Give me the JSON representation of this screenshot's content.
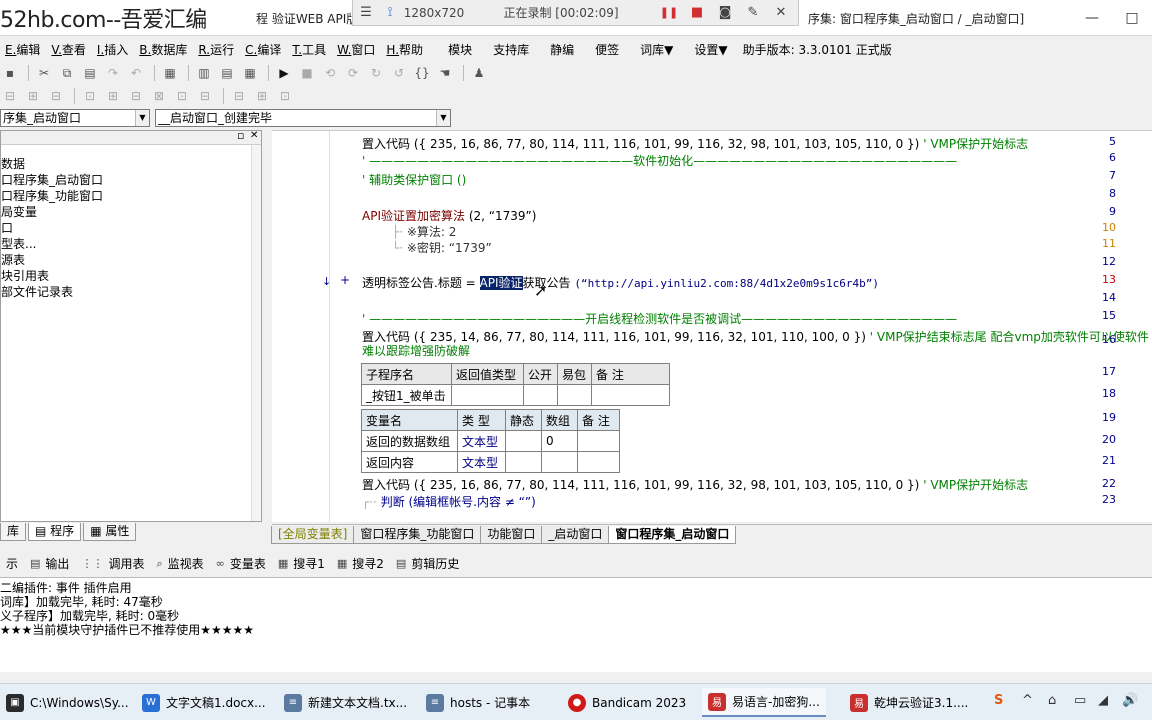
{
  "title_bar": {
    "watermark": "52hb.com--吾爱汇编",
    "title_mid": "程  验证WEB API版本",
    "title_right": "序集: 窗口程序集_启动窗口 / _启动窗口]",
    "minimize": "—",
    "maximize": "□",
    "close": "✕"
  },
  "recorder": {
    "menu_icon": "☰",
    "pin_icon": "⟟",
    "resolution": "1280x720",
    "status": "正在录制 [00:02:09]",
    "pause": "❚❚",
    "stop": "■",
    "camera": "◙",
    "pen": "✎",
    "close": "✕",
    "colors": {
      "pause": "#d03030",
      "stop": "#d03030"
    }
  },
  "menu": [
    {
      "label": "E.编辑"
    },
    {
      "label": "V.查看"
    },
    {
      "label": "I.插入"
    },
    {
      "label": "B.数据库"
    },
    {
      "label": "R.运行"
    },
    {
      "label": "C.编译"
    },
    {
      "label": "T.工具"
    },
    {
      "label": "W.窗口"
    },
    {
      "label": "H.帮助"
    },
    {
      "label": "模块"
    },
    {
      "label": "支持库"
    },
    {
      "label": "静编"
    },
    {
      "label": "便签"
    },
    {
      "label": "词库▼"
    },
    {
      "label": "设置▼"
    },
    {
      "label": "助手版本: 3.3.0101 正式版"
    }
  ],
  "combos": {
    "left": "序集_启动窗口",
    "right": "__启动窗口_创建完毕",
    "arrow": "▼"
  },
  "tree": {
    "pin": "▫",
    "close": "✕",
    "items": [
      "数据",
      "口程序集_启动窗口",
      "口程序集_功能窗口",
      "局变量",
      "口",
      "型表...",
      "源表",
      "块引用表",
      "部文件记录表"
    ]
  },
  "left_tabs": [
    "库",
    "程序",
    "属性"
  ],
  "editor": {
    "line_numbers": [
      "5",
      "6",
      "7",
      "8",
      "9",
      "10",
      "11",
      "12",
      "13",
      "14",
      "15",
      "16",
      "17",
      "18",
      "19",
      "20",
      "21",
      "22",
      "23"
    ],
    "lines": {
      "l5_func": "置入代码",
      "l5_args": "({ 235, 16, 86, 77, 80, 114, 111, 116, 101, 99, 116, 32, 98, 101, 103, 105, 110, 0 })",
      "l5_comment": "' VMP保护开始标志",
      "l6_comment": "' ——————————————————————软件初始化——————————————————————",
      "l7_comment": "' 辅助类保护窗口 ()",
      "l9_func": "API验证置加密算法",
      "l9_args": "(2, “1739”)",
      "l10_param": "※算法: 2",
      "l11_param": "※密钥: “1739”",
      "l13_lhs": "透明标签公告.标题 = ",
      "l13_sel": "API验证",
      "l13_rest": "获取公告",
      "l13_str": "(“http://api.yinliu2.com:88/4d1x2e0m9s1c6r4b”)",
      "l15_comment": "' ——————————————————开启线程检测软件是否被调试——————————————————",
      "l16_func": "置入代码",
      "l16_args": "({ 235, 14, 86, 77, 80, 114, 111, 116, 101, 99, 116, 32, 101, 110, 100, 0 })",
      "l16_comment": "' VMP保护结束标志尾  配合vmp加壳软件可以使软件",
      "l16_cont": "难以跟踪增强防破解",
      "l22_func": "置入代码",
      "l22_args": "({ 235, 16, 86, 77, 80, 114, 111, 116, 101, 99, 116, 32, 98, 101, 103, 105, 110, 0 })",
      "l22_comment": "' VMP保护开始标志",
      "l23_code": "判断 (编辑框帐号.内容 ≠ “”)"
    },
    "markers": {
      "arrow": "↓",
      "plus": "+"
    },
    "sub_table": {
      "headers": [
        "子程序名",
        "返回值类型",
        "公开",
        "易包",
        "备 注"
      ],
      "row": [
        "_按钮1_被单击",
        "",
        "",
        "",
        ""
      ]
    },
    "var_table": {
      "headers": [
        "变量名",
        "类 型",
        "静态",
        "数组",
        "备 注"
      ],
      "rows": [
        [
          "返回的数据数组",
          "文本型",
          "",
          "0",
          ""
        ],
        [
          "返回内容",
          "文本型",
          "",
          "",
          ""
        ]
      ]
    }
  },
  "editor_tabs": [
    "[全局变量表]",
    "窗口程序集_功能窗口",
    "功能窗口",
    "_启动窗口",
    "窗口程序集_启动窗口"
  ],
  "output_tabs": [
    {
      "label": "示",
      "icon": ""
    },
    {
      "label": "输出",
      "icon": "▤"
    },
    {
      "label": "调用表",
      "icon": "⋮⋮"
    },
    {
      "label": "监视表",
      "icon": "⌕"
    },
    {
      "label": "变量表",
      "icon": "∞"
    },
    {
      "label": "搜寻1",
      "icon": "▦"
    },
    {
      "label": "搜寻2",
      "icon": "▦"
    },
    {
      "label": "剪辑历史",
      "icon": "▤"
    }
  ],
  "output_lines": [
    "二编插件: 事件 插件启用",
    "词库】加载完毕, 耗时: 47毫秒",
    "义子程序】加载完毕, 耗时: 0毫秒",
    "★★★当前模块守护插件已不推荐使用★★★★★"
  ],
  "taskbar": {
    "items": [
      {
        "label": "C:\\Windows\\Sy...",
        "icon": "▣",
        "color": "#2b2b2b"
      },
      {
        "label": "文字文稿1.docx...",
        "icon": "W",
        "color": "#2a6fd4"
      },
      {
        "label": "新建文本文档.tx...",
        "icon": "≡",
        "color": "#5a7aa0"
      },
      {
        "label": "hosts - 记事本",
        "icon": "≡",
        "color": "#5a7aa0"
      },
      {
        "label": "Bandicam 2023",
        "icon": "●",
        "color": "#d01818"
      },
      {
        "label": "易语言-加密狗...",
        "icon": "易",
        "color": "#c83030"
      },
      {
        "label": "乾坤云验证3.1....",
        "icon": "易",
        "color": "#c83030"
      }
    ],
    "tray": [
      "S",
      "^",
      "⌂",
      "▭",
      "◢",
      "🔊"
    ]
  }
}
